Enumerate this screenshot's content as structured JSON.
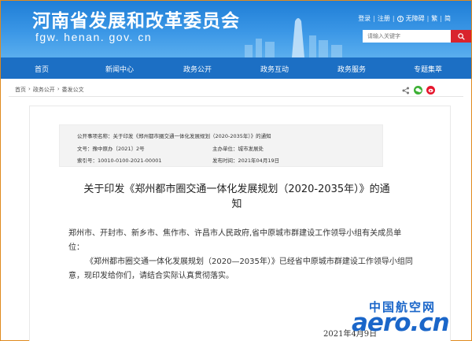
{
  "site": {
    "title": "河南省发展和改革委员会",
    "domain": "fgw. henan. gov. cn"
  },
  "top_links": {
    "login": "登录",
    "register": "注册",
    "accessibility": "无障碍",
    "traditional": "繁",
    "english": "简"
  },
  "search": {
    "placeholder": "请输入关键字"
  },
  "nav": [
    "首页",
    "新闻中心",
    "政务公开",
    "政务互动",
    "政务服务",
    "专题集萃"
  ],
  "breadcrumb": [
    "首页",
    "政务公开",
    "委发公文"
  ],
  "meta": {
    "subject": "公开事项名称：关于印发《郑州都市圈交通一体化发展规划（2020-2035年）》的通知",
    "doc_no": "文号：豫中原办〔2021〕2号",
    "publisher": "主办单位：城市发展处",
    "index_no": "索引号：10010-0100-2021-00001",
    "pub_date": "发布时间：2021年04月19日"
  },
  "document": {
    "title_line1": "关于印发《郑州都市圈交通一体化发展规划（2020-2035年）》的通",
    "title_line2": "知",
    "recipients": "郑州市、开封市、新乡市、焦作市、许昌市人民政府,省中原城市群建设工作领导小组有关成员单位：",
    "paragraph1": "《郑州都市圈交通一体化发展规划（2020—2035年）》已经省中原城市群建设工作领导小组同意，现印发给你们，请结合实际认真贯彻落实。",
    "date": "2021年4月9日"
  },
  "watermark": {
    "top": "中国航空网",
    "main": "aero.cn"
  },
  "colors": {
    "header": "#2a86dc",
    "nav": "#1c6fc4",
    "search_button": "#d9232d",
    "wechat": "#3cb034",
    "weibo": "#e6162d"
  }
}
